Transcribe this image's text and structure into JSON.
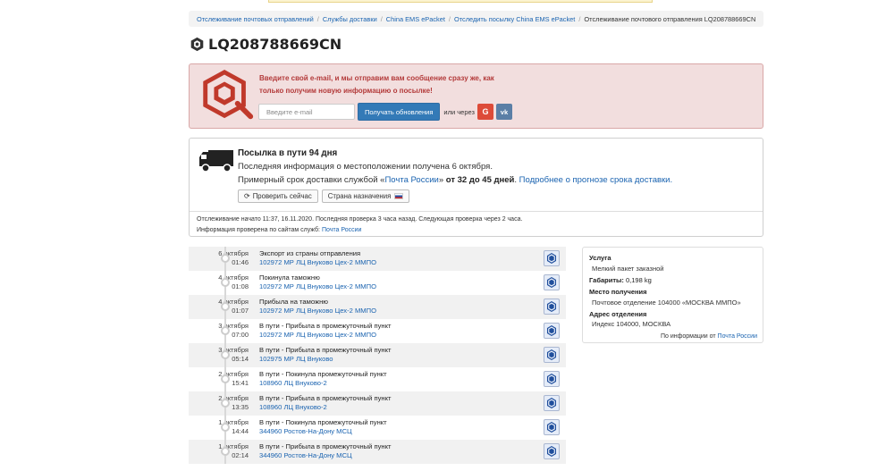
{
  "breadcrumb": [
    "Отслеживание почтовых отправлений",
    "Службы доставки",
    "China EMS ePacket",
    "Отследить посылку China EMS ePacket",
    "Отслеживание почтового отправления LQ208788669CN"
  ],
  "tracking_number": "LQ208788669CN",
  "subscribe": {
    "message_line1": "Введите свой e-mail, и мы отправим вам сообщение сразу же, как",
    "message_line2": "только получим новую информацию о посылке!",
    "email_placeholder": "Введите e-mail",
    "button_label": "Получать обновления",
    "or_via": "или через",
    "google_label": "G",
    "vk_label": "vk"
  },
  "status": {
    "title": "Посылка в пути 94 дня",
    "last_info": "Последняя информация о местоположении получена 6 октября.",
    "estimate_prefix": "Примерный срок доставки службой «",
    "estimate_service": "Почта России",
    "estimate_suffix": "» ",
    "estimate_range": "от 32 до 45 дней",
    "estimate_end": ".",
    "forecast_link": "Подробнее о прогнозе срока доставки.",
    "check_now_label": "Проверить сейчас",
    "destination_label": "Страна назначения",
    "meta_line1": "Отслеживание начато 11:37, 16.11.2020. Последняя проверка 3 часа назад. Следующая проверка через 2 часа.",
    "meta_line2_prefix": "Информация проверена по сайтам служб:",
    "meta_line2_service": "Почта России"
  },
  "events": [
    {
      "date": "6 октября",
      "time": "01:46",
      "status": "Экспорт из страны отправления",
      "place": "102972 МР ЛЦ Внуково Цех-2 ММПО"
    },
    {
      "date": "4 октября",
      "time": "01:08",
      "status": "Покинула таможню",
      "place": "102972 МР ЛЦ Внуково Цех-2 ММПО"
    },
    {
      "date": "4 октября",
      "time": "01:07",
      "status": "Прибыла на таможню",
      "place": "102972 МР ЛЦ Внуково Цех-2 ММПО"
    },
    {
      "date": "3 октября",
      "time": "07:00",
      "status": "В пути - Прибыла в промежуточный пункт",
      "place": "102972 МР ЛЦ Внуково Цех-2 ММПО"
    },
    {
      "date": "3 октября",
      "time": "05:14",
      "status": "В пути - Прибыла в промежуточный пункт",
      "place": "102975 МР ЛЦ Внуково"
    },
    {
      "date": "2 октября",
      "time": "15:41",
      "status": "В пути - Покинула промежуточный пункт",
      "place": "108960 ЛЦ Внуково-2"
    },
    {
      "date": "2 октября",
      "time": "13:35",
      "status": "В пути - Прибыла в промежуточный пункт",
      "place": "108960 ЛЦ Внуково-2"
    },
    {
      "date": "1 октября",
      "time": "14:44",
      "status": "В пути - Покинула промежуточный пункт",
      "place": "344960 Ростов-На-Дону МСЦ"
    },
    {
      "date": "1 октября",
      "time": "02:14",
      "status": "В пути - Прибыла в промежуточный пункт",
      "place": "344960 Ростов-На-Дону МСЦ"
    }
  ],
  "service_info": {
    "service_label": "Услуга",
    "service_value": "Мелкий пакет заказной",
    "dimensions_label": "Габариты:",
    "dimensions_value": "0,198 kg",
    "pickup_label": "Место получения",
    "pickup_value": "Почтовое отделение 104000 «МОСКВА ММПО»",
    "address_label": "Адрес отделения",
    "address_value": "Индекс 104000, МОСКВА",
    "source_prefix": "По информации от",
    "source_service": "Почта России"
  },
  "colors": {
    "link": "#1a63b0",
    "alert_text": "#b33a3a",
    "alert_bg": "#f2dede",
    "primary_button": "#337ab7",
    "google": "#dd4b39",
    "vk": "#5b7fa6"
  }
}
